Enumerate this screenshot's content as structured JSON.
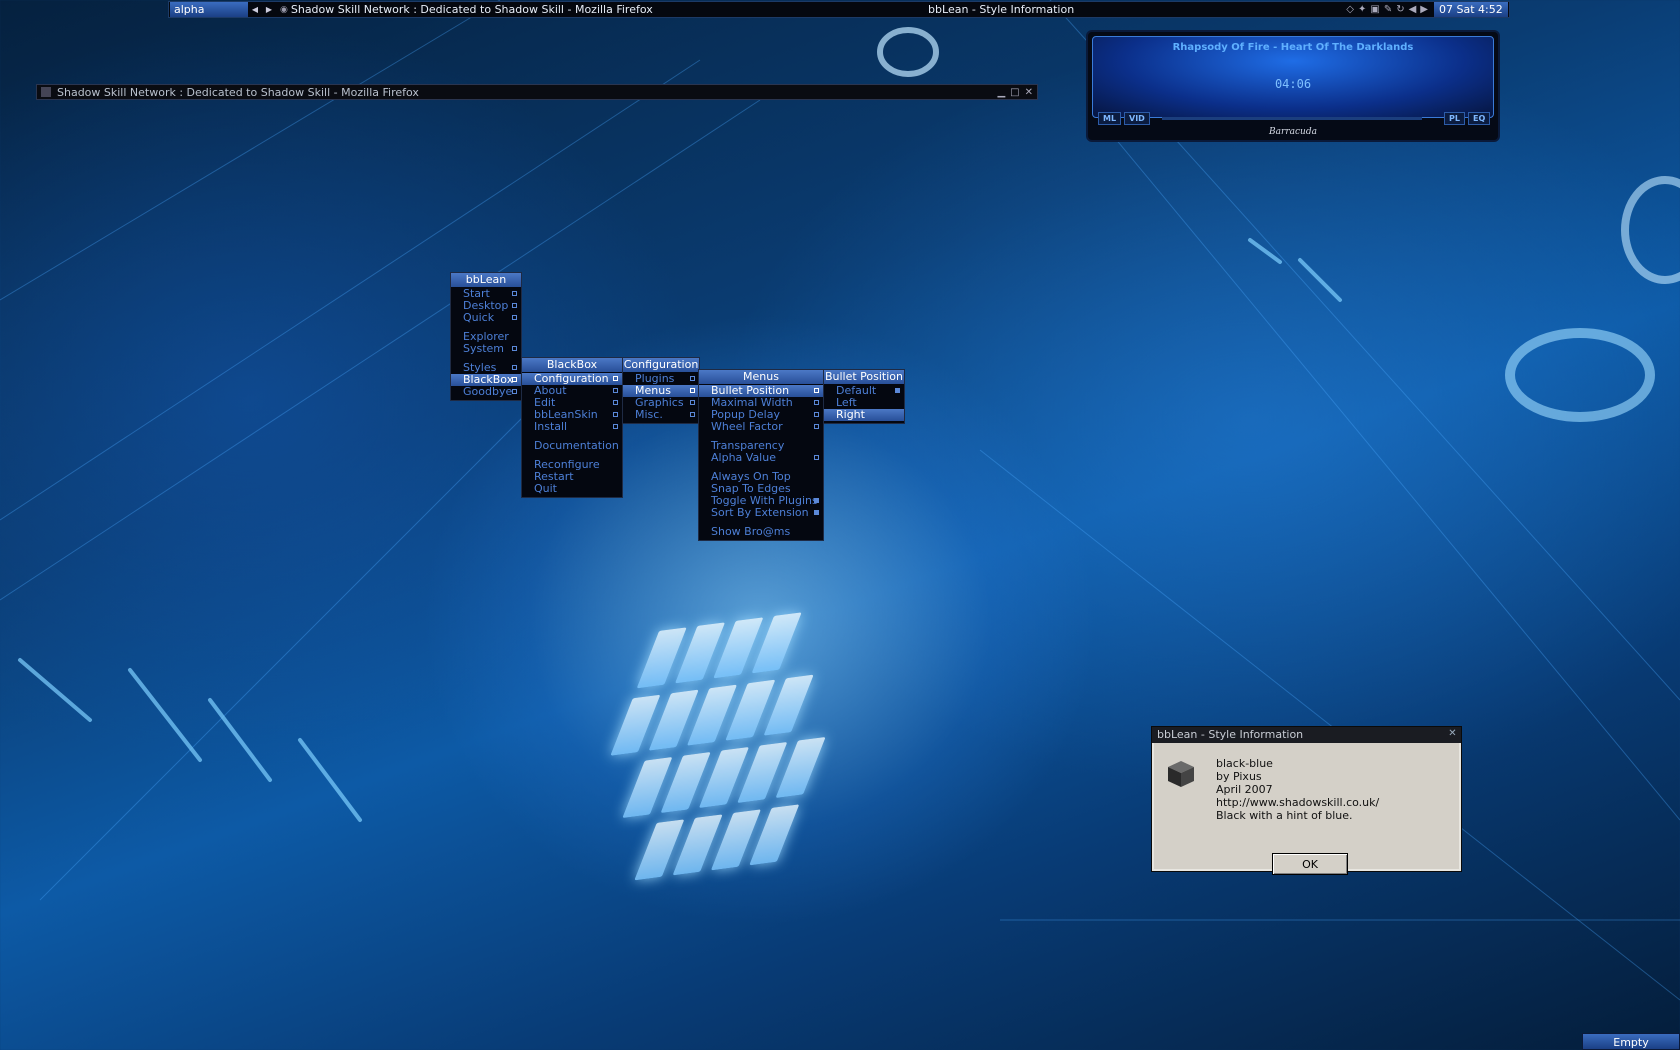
{
  "toolbar": {
    "workspace": "alpha",
    "task_title": "Shadow Skill Network : Dedicated to Shadow Skill - Mozilla Firefox",
    "center_title": "bbLean - Style Information",
    "clock": "07 Sat 4:52"
  },
  "firefox_window": {
    "title": "Shadow Skill Network : Dedicated to Shadow Skill - Mozilla Firefox"
  },
  "player": {
    "track": "Rhapsody Of Fire - Heart Of The Darklands",
    "time": "04:06",
    "buttons": [
      "ML",
      "VID",
      "PL",
      "EQ"
    ],
    "skin_name": "Barracuda"
  },
  "menus": {
    "root": {
      "title": "bbLean",
      "items": [
        {
          "label": "Start",
          "bullet": true
        },
        {
          "label": "Desktop",
          "bullet": true
        },
        {
          "label": "Quick",
          "bullet": true
        },
        {
          "label": "Explorer",
          "bullet": false
        },
        {
          "label": "System",
          "bullet": true
        },
        {
          "label": "Styles",
          "bullet": true
        },
        {
          "label": "BlackBox",
          "bullet": true
        },
        {
          "label": "Goodbye",
          "bullet": true
        }
      ]
    },
    "blackbox": {
      "title": "BlackBox",
      "items": [
        {
          "label": "Configuration",
          "bullet": true
        },
        {
          "label": "About",
          "bullet": true
        },
        {
          "label": "Edit",
          "bullet": true
        },
        {
          "label": "bbLeanSkin",
          "bullet": true
        },
        {
          "label": "Install",
          "bullet": true
        },
        {
          "label": "Documentation",
          "bullet": false
        },
        {
          "label": "Reconfigure",
          "bullet": false
        },
        {
          "label": "Restart",
          "bullet": false
        },
        {
          "label": "Quit",
          "bullet": false
        }
      ]
    },
    "configuration": {
      "title": "Configuration",
      "items": [
        {
          "label": "Plugins",
          "bullet": true
        },
        {
          "label": "Menus",
          "bullet": true
        },
        {
          "label": "Graphics",
          "bullet": true
        },
        {
          "label": "Misc.",
          "bullet": true
        }
      ]
    },
    "menus_sub": {
      "title": "Menus",
      "items": [
        {
          "label": "Bullet Position",
          "bullet": true
        },
        {
          "label": "Maximal Width",
          "bullet": true
        },
        {
          "label": "Popup Delay",
          "bullet": true
        },
        {
          "label": "Wheel Factor",
          "bullet": true
        },
        {
          "label": "Transparency",
          "bullet": false
        },
        {
          "label": "Alpha Value",
          "bullet": true
        },
        {
          "label": "Always On Top",
          "bullet": false
        },
        {
          "label": "Snap To Edges",
          "bullet": false
        },
        {
          "label": "Toggle With Plugins",
          "bullet": true
        },
        {
          "label": "Sort By Extension",
          "bullet": true
        },
        {
          "label": "Show Bro@ms",
          "bullet": false
        }
      ]
    },
    "bullet_position": {
      "title": "Bullet Position",
      "items": [
        {
          "label": "Default",
          "bullet": true
        },
        {
          "label": "Left",
          "bullet": false
        },
        {
          "label": "Right",
          "bullet": false
        }
      ]
    }
  },
  "dialog": {
    "title": "bbLean - Style Information",
    "style_name": "black-blue",
    "author": "by Pixus",
    "date": "April 2007",
    "url": "http://www.shadowskill.co.uk/",
    "description": "Black with a hint of blue.",
    "ok_label": "OK"
  },
  "bottom_right_label": "Empty"
}
